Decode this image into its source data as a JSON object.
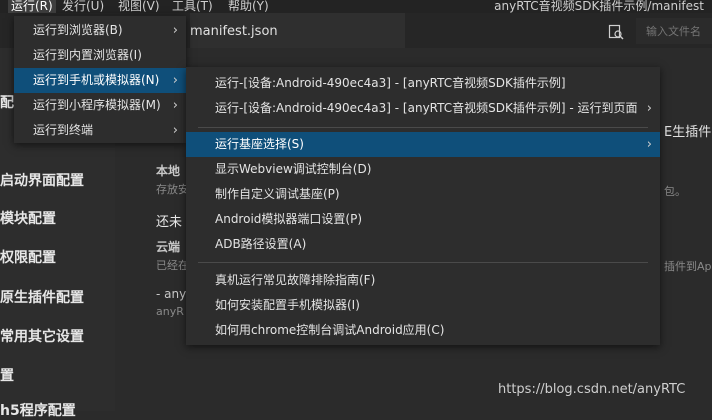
{
  "menubar": {
    "items": [
      "运行(R)",
      "发行(U)",
      "视图(V)",
      "工具(T)",
      "帮助(Y)"
    ],
    "window_title": "anyRTC音视频SDK插件示例/manifest"
  },
  "tab": {
    "label": "manifest.json"
  },
  "search": {
    "placeholder": "输入文件名"
  },
  "sidebar": {
    "items": [
      "配",
      "",
      "启动界面配置",
      "模块配置",
      "权限配置",
      "原生插件配置",
      "常用其它设置",
      "置",
      "h5程序配置"
    ]
  },
  "content": {
    "local_title": "本地",
    "local_desc": "存放安",
    "local_desc_right": "包。",
    "not_done": "还未",
    "cloud_title": "云端",
    "cloud_desc": "已经在",
    "cloud_desc_right": "插件到Ap",
    "any_line": "- any",
    "any_sub": "anyR",
    "native_plugin_right": "E生插件,"
  },
  "run_menu": {
    "items": [
      {
        "label": "运行到浏览器(B)",
        "submenu": true
      },
      {
        "label": "运行到内置浏览器(I)",
        "submenu": false
      },
      {
        "label": "运行到手机或模拟器(N)",
        "submenu": true,
        "highlighted": true
      },
      {
        "label": "运行到小程序模拟器(M)",
        "submenu": true
      },
      {
        "label": "运行到终端",
        "submenu": true
      }
    ]
  },
  "device_menu": {
    "items": [
      {
        "label": "运行-[设备:Android-490ec4a3] - [anyRTC音视频SDK插件示例]",
        "submenu": false
      },
      {
        "label": "运行-[设备:Android-490ec4a3] - [anyRTC音视频SDK插件示例] - 运行到页面",
        "submenu": true
      },
      {
        "label": "运行基座选择(S)",
        "submenu": true,
        "highlighted": true
      },
      {
        "label": "显示Webview调试控制台(D)",
        "submenu": false
      },
      {
        "label": "制作自定义调试基座(P)",
        "submenu": false
      },
      {
        "label": "Android模拟器端口设置(P)",
        "submenu": false
      },
      {
        "label": "ADB路径设置(A)",
        "submenu": false
      },
      {
        "label": "真机运行常见故障排除指南(F)",
        "submenu": false
      },
      {
        "label": "如何安装配置手机模拟器(I)",
        "submenu": false
      },
      {
        "label": "如何用chrome控制台调试Android应用(C)",
        "submenu": false
      }
    ]
  },
  "watermark": "https://blog.csdn.net/anyRTC",
  "colors": {
    "highlight": "#0f4f7a",
    "menu_bg": "#2d2d2d",
    "editor_bg": "#2b2b2b"
  }
}
